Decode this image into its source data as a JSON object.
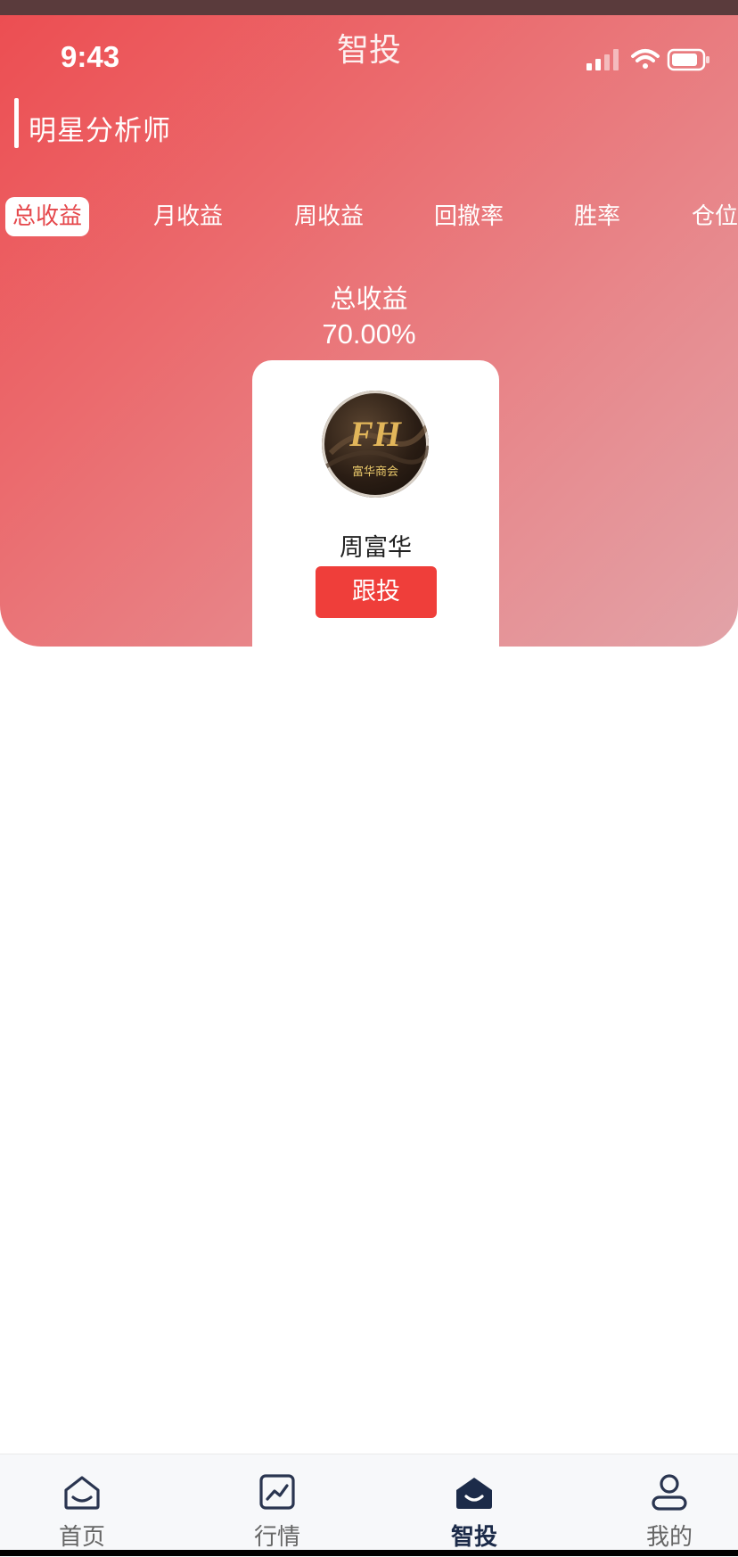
{
  "status_bar": {
    "time": "9:43"
  },
  "header": {
    "title": "智投"
  },
  "section": {
    "title": "明星分析师"
  },
  "tabs": [
    {
      "label": "总收益",
      "active": true
    },
    {
      "label": "月收益",
      "active": false
    },
    {
      "label": "周收益",
      "active": false
    },
    {
      "label": "回撤率",
      "active": false
    },
    {
      "label": "胜率",
      "active": false
    },
    {
      "label": "仓位",
      "active": false
    }
  ],
  "metric": {
    "label": "总收益",
    "value": "70.00%"
  },
  "analyst_card": {
    "logo_initials": "FH",
    "logo_text": "富华商会",
    "name": "周富华",
    "follow_label": "跟投"
  },
  "bottom_nav": [
    {
      "label": "首页",
      "icon": "home-icon",
      "active": false
    },
    {
      "label": "行情",
      "icon": "chart-icon",
      "active": false
    },
    {
      "label": "智投",
      "icon": "smart-invest-icon",
      "active": true
    },
    {
      "label": "我的",
      "icon": "profile-icon",
      "active": false
    }
  ],
  "colors": {
    "accent": "#ef3e3a",
    "nav_active": "#1c2b49",
    "nav_inactive": "#666666"
  }
}
